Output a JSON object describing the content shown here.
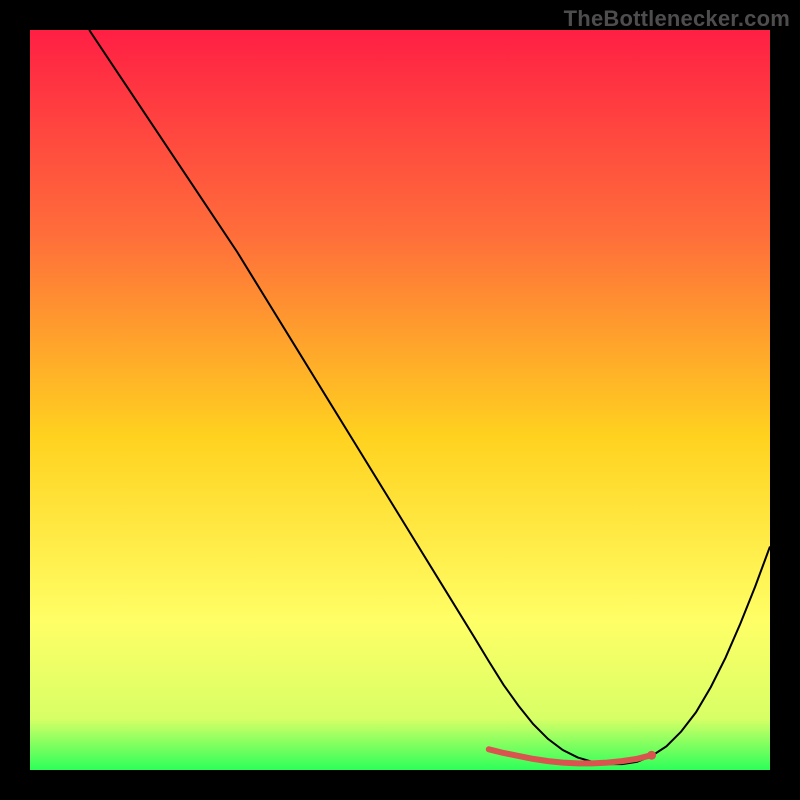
{
  "watermark": "TheBottlenecker.com",
  "chart_data": {
    "type": "line",
    "title": "",
    "xlabel": "",
    "ylabel": "",
    "xlim": [
      0,
      100
    ],
    "ylim": [
      0,
      100
    ],
    "grid": false,
    "background_gradient": {
      "stops": [
        {
          "offset": 0.0,
          "color": "#ff1f44"
        },
        {
          "offset": 0.28,
          "color": "#ff6f3a"
        },
        {
          "offset": 0.55,
          "color": "#ffd21f"
        },
        {
          "offset": 0.8,
          "color": "#ffff66"
        },
        {
          "offset": 0.93,
          "color": "#d8ff66"
        },
        {
          "offset": 1.0,
          "color": "#2dff5a"
        }
      ]
    },
    "series": [
      {
        "name": "bottleneck-curve",
        "color": "#000000",
        "stroke_width": 2,
        "x": [
          8,
          12,
          16,
          20,
          24,
          28,
          32,
          36,
          40,
          44,
          48,
          52,
          56,
          60,
          62,
          64,
          66,
          68,
          70,
          72,
          74,
          76,
          78,
          80,
          82,
          84,
          86,
          88,
          90,
          92,
          94,
          96,
          98,
          100
        ],
        "y": [
          100,
          94,
          88,
          82,
          76,
          70,
          63.5,
          57,
          50.5,
          44,
          37.5,
          31,
          24.5,
          18,
          14.7,
          11.5,
          8.7,
          6.2,
          4.2,
          2.7,
          1.7,
          1.1,
          0.8,
          0.8,
          1.1,
          1.9,
          3.2,
          5.2,
          7.8,
          11.2,
          15.2,
          19.8,
          24.8,
          30.2
        ]
      },
      {
        "name": "optimal-range-marker",
        "color": "#d9534f",
        "stroke_width": 6,
        "linecap": "round",
        "x": [
          62,
          64,
          66,
          68,
          70,
          72,
          74,
          76,
          78,
          80,
          82,
          84
        ],
        "y": [
          2.8,
          2.3,
          1.9,
          1.5,
          1.2,
          1.0,
          0.9,
          0.9,
          1.0,
          1.2,
          1.5,
          2.0
        ]
      }
    ],
    "markers": [
      {
        "name": "optimal-end-dot",
        "x": 84,
        "y": 2.0,
        "r": 4.5,
        "color": "#d9534f"
      }
    ]
  }
}
